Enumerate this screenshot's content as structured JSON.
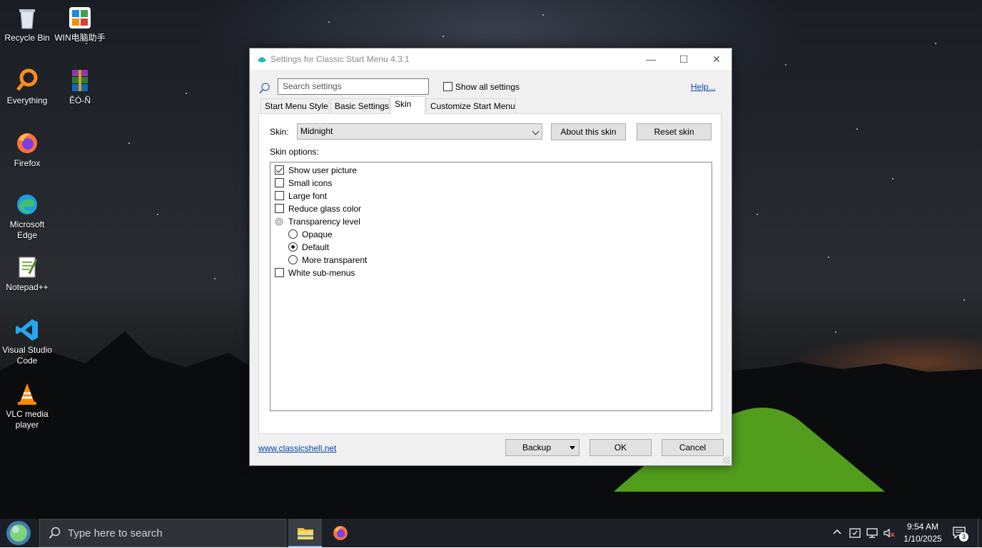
{
  "desktop": {
    "icons": [
      {
        "label": "Recycle Bin",
        "icon": "recycle-bin-icon"
      },
      {
        "label": "WIN电脑助手",
        "icon": "win-assistant-icon"
      },
      {
        "label": "Everything",
        "icon": "everything-icon"
      },
      {
        "label": "ÊÒ-Ñ",
        "icon": "winrar-icon"
      },
      {
        "label": "Firefox",
        "icon": "firefox-icon"
      },
      {
        "label": "Microsoft Edge",
        "icon": "edge-icon"
      },
      {
        "label": "Notepad++",
        "icon": "notepadpp-icon"
      },
      {
        "label": "Visual Studio Code",
        "icon": "vscode-icon"
      },
      {
        "label": "VLC media player",
        "icon": "vlc-icon"
      }
    ]
  },
  "window": {
    "title": "Settings for Classic Start Menu 4.3.1",
    "controls": {
      "minimize": "—",
      "maximize": "☐",
      "close": "✕"
    },
    "search": {
      "placeholder": "Search settings"
    },
    "show_all": {
      "label": "Show all settings",
      "checked": false
    },
    "help_label": "Help...",
    "tabs": [
      {
        "label": "Start Menu Style",
        "active": false
      },
      {
        "label": "Basic Settings",
        "active": false
      },
      {
        "label": "Skin",
        "active": true
      },
      {
        "label": "Customize Start Menu",
        "active": false
      }
    ],
    "skin": {
      "label": "Skin:",
      "value": "Midnight",
      "about_button": "About this skin",
      "reset_button": "Reset skin",
      "options_label": "Skin options:",
      "options": [
        {
          "type": "checkbox",
          "label": "Show user picture",
          "checked": true
        },
        {
          "type": "checkbox",
          "label": "Small icons",
          "checked": false
        },
        {
          "type": "checkbox",
          "label": "Large font",
          "checked": false
        },
        {
          "type": "checkbox",
          "label": "Reduce glass color",
          "checked": false
        },
        {
          "type": "group",
          "label": "Transparency level"
        },
        {
          "type": "radio",
          "label": "Opaque",
          "checked": false
        },
        {
          "type": "radio",
          "label": "Default",
          "checked": true
        },
        {
          "type": "radio",
          "label": "More transparent",
          "checked": false
        },
        {
          "type": "checkbox",
          "label": "White sub-menus",
          "checked": false
        }
      ]
    },
    "footer": {
      "link": "www.classicshell.net",
      "backup_button": "Backup",
      "ok_button": "OK",
      "cancel_button": "Cancel"
    }
  },
  "taskbar": {
    "search_placeholder": "Type here to search",
    "time": "9:54 AM",
    "date": "1/10/2025",
    "notification_count": "3"
  }
}
